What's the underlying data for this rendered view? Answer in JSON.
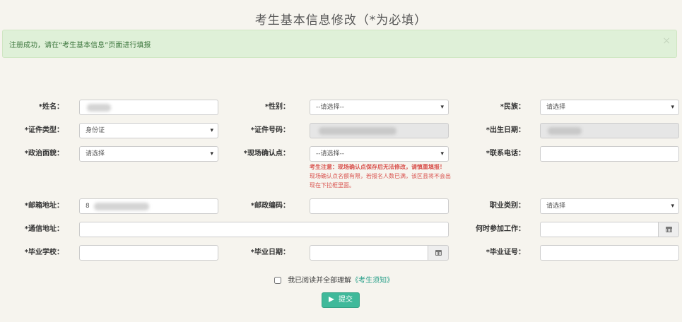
{
  "page": {
    "title": "考生基本信息修改（*为必填）"
  },
  "alert": {
    "message": "注册成功，请在“考生基本信息”页面进行填报",
    "close": "×"
  },
  "form": {
    "name_label": "*姓名：",
    "gender_label": "*性别：",
    "gender_value": "--请选择--",
    "ethnicity_label": "*民族：",
    "ethnicity_value": "请选择",
    "id_type_label": "*证件类型：",
    "id_type_value": "身份证",
    "id_number_label": "*证件号码：",
    "birth_label": "*出生日期：",
    "political_label": "*政治面貌：",
    "political_value": "请选择",
    "confirm_site_label": "*现场确认点：",
    "confirm_site_value": "--请选择--",
    "phone_label": "*联系电话：",
    "notice_line1": "考生注意：现场确认点保存后无法修改，请慎重填报！",
    "notice_line2": "现场确认点名额有限，若报名人数已满，该区县将不会出现在下拉框里面。",
    "email_label": "*邮箱地址：",
    "email_value_prefix": "8",
    "postcode_label": "*邮政编码：",
    "job_label": "职业类别：",
    "job_value": "请选择",
    "address_label": "*通信地址：",
    "work_start_label": "何时参加工作：",
    "school_label": "*毕业学校：",
    "grad_date_label": "*毕业日期：",
    "cert_no_label": "*毕业证号："
  },
  "agreement": {
    "text": "我已阅读并全部理解",
    "link": "《考生须知》"
  },
  "submit": {
    "label": "提交"
  }
}
